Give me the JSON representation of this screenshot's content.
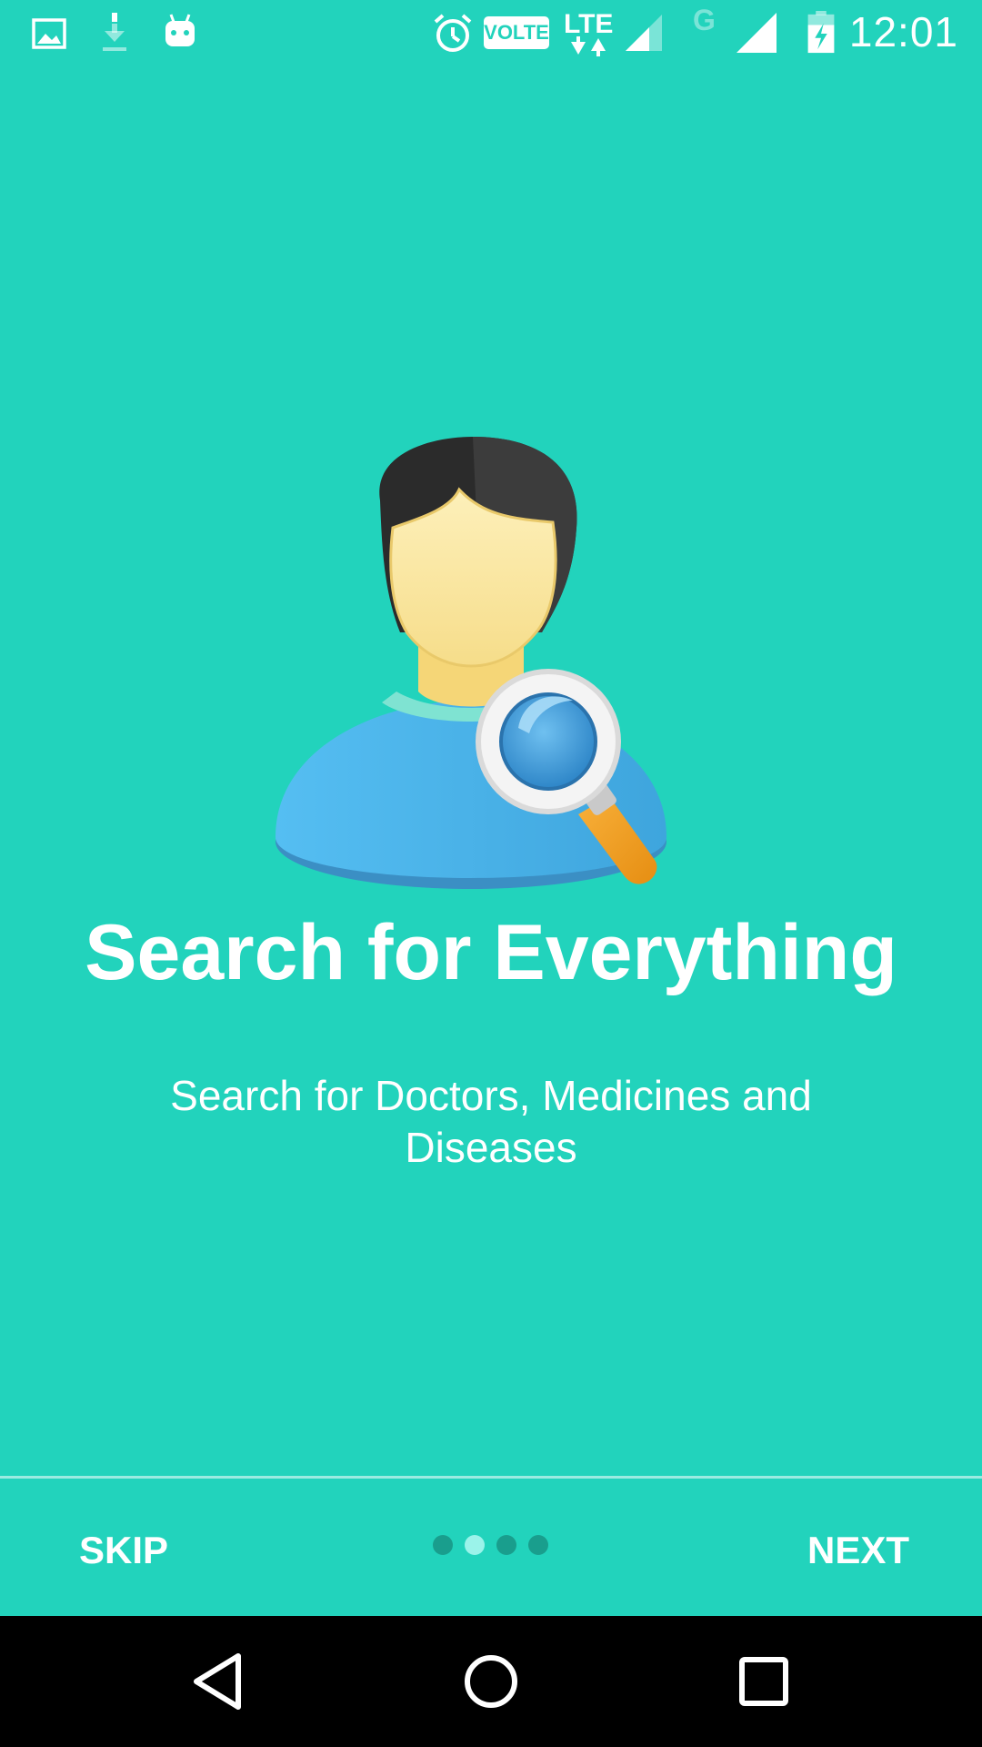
{
  "status_bar": {
    "time": "12:01",
    "volte_label": "VOLTE",
    "lte_label": "LTE",
    "network_g_label": "G",
    "icons": [
      "image-icon",
      "download-icon",
      "android-icon",
      "alarm-icon",
      "volte-icon",
      "lte-icon",
      "signal-icon",
      "signal-icon",
      "battery-charging-icon"
    ]
  },
  "onboarding": {
    "illustration": "user-search-icon",
    "title": "Search for Everything",
    "description": "Search for Doctors, Medicines and Diseases",
    "page_count": 4,
    "active_page": 2
  },
  "bottom_bar": {
    "skip_label": "SKIP",
    "next_label": "NEXT"
  },
  "nav_bar": {
    "icons": [
      "back-icon",
      "home-icon",
      "recents-icon"
    ]
  },
  "colors": {
    "background": "#22D3BC",
    "indicator_active": "#9BF3EA",
    "nav_bar": "#000000"
  }
}
